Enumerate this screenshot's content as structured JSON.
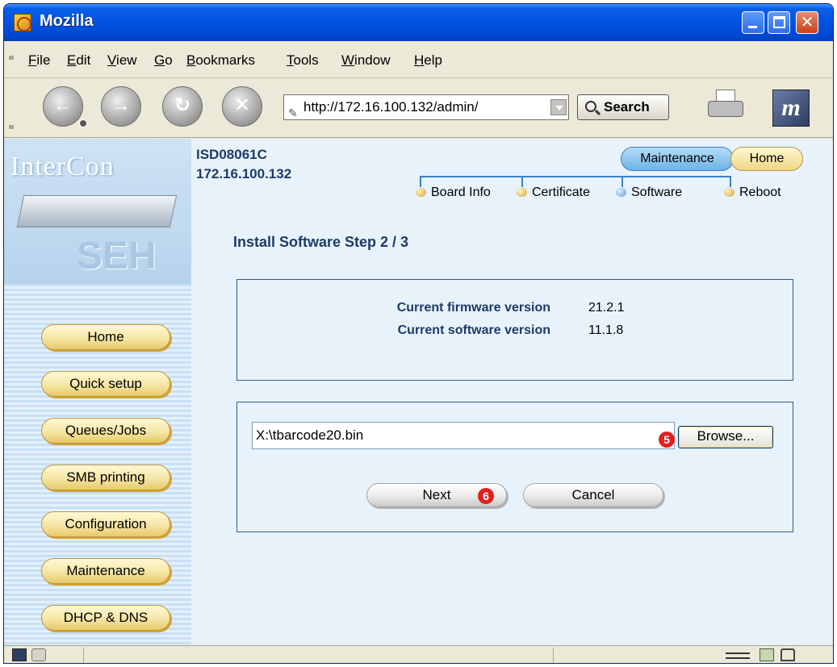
{
  "window": {
    "title": "Mozilla"
  },
  "menu": [
    "File",
    "Edit",
    "View",
    "Go",
    "Bookmarks",
    "Tools",
    "Window",
    "Help"
  ],
  "toolbar": {
    "url": "http://172.16.100.132/admin/",
    "search_label": "Search"
  },
  "device": {
    "name": "ISD08061C",
    "ip": "172.16.100.132"
  },
  "top_tabs": {
    "maintenance": "Maintenance",
    "home": "Home"
  },
  "subnav": [
    "Board Info",
    "Certificate",
    "Software",
    "Reboot"
  ],
  "sidebar": {
    "logo_text": "InterCon",
    "brand": "SEH",
    "items": [
      "Home",
      "Quick setup",
      "Queues/Jobs",
      "SMB printing",
      "Configuration",
      "Maintenance",
      "DHCP & DNS"
    ]
  },
  "page": {
    "title": "Install Software Step 2 / 3",
    "firmware_label": "Current firmware version",
    "firmware_value": "21.2.1",
    "software_label": "Current software version",
    "software_value": "11.1.8",
    "file_value": "X:\\tbarcode20.bin",
    "browse_label": "Browse...",
    "next_label": "Next",
    "cancel_label": "Cancel",
    "marker_browse": "5",
    "marker_next": "6"
  },
  "colors": {
    "titlebar": "#0053e1",
    "content_bg": "#e8f2fb",
    "heading": "#1d3b66",
    "marker": "#e41f1f",
    "sidebar_button": "#f5e6a6"
  }
}
